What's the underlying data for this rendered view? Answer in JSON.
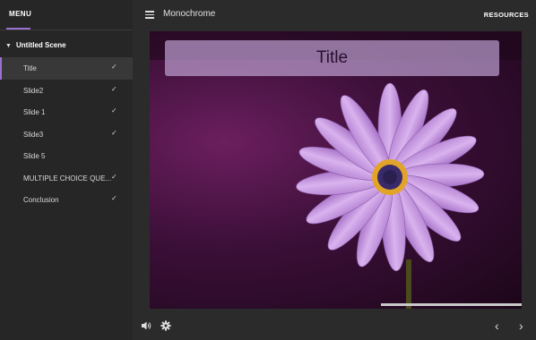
{
  "sidebar": {
    "menu_label": "MENU",
    "scene_title": "Untitled Scene",
    "slides": [
      {
        "label": "Title",
        "checked": "✓"
      },
      {
        "label": "Slide2",
        "checked": "✓"
      },
      {
        "label": "Slide 1",
        "checked": "✓"
      },
      {
        "label": "Slide3",
        "checked": "✓"
      },
      {
        "label": "Slide 5",
        "checked": ""
      },
      {
        "label": "MULTIPLE CHOICE QUE...",
        "checked": "✓"
      },
      {
        "label": "Conclusion",
        "checked": "✓"
      }
    ]
  },
  "topbar": {
    "title": "Monochrome",
    "resources_label": "RESOURCES"
  },
  "stage": {
    "slide_title": "Title"
  },
  "footer": {
    "volume_icon": "volume-icon",
    "settings_icon": "gear-icon",
    "prev_icon": "chevron-left-icon",
    "next_icon": "chevron-right-icon"
  },
  "colors": {
    "accent": "#9b6fd3",
    "background": "#2b2b2b",
    "sidebar": "#262626"
  }
}
